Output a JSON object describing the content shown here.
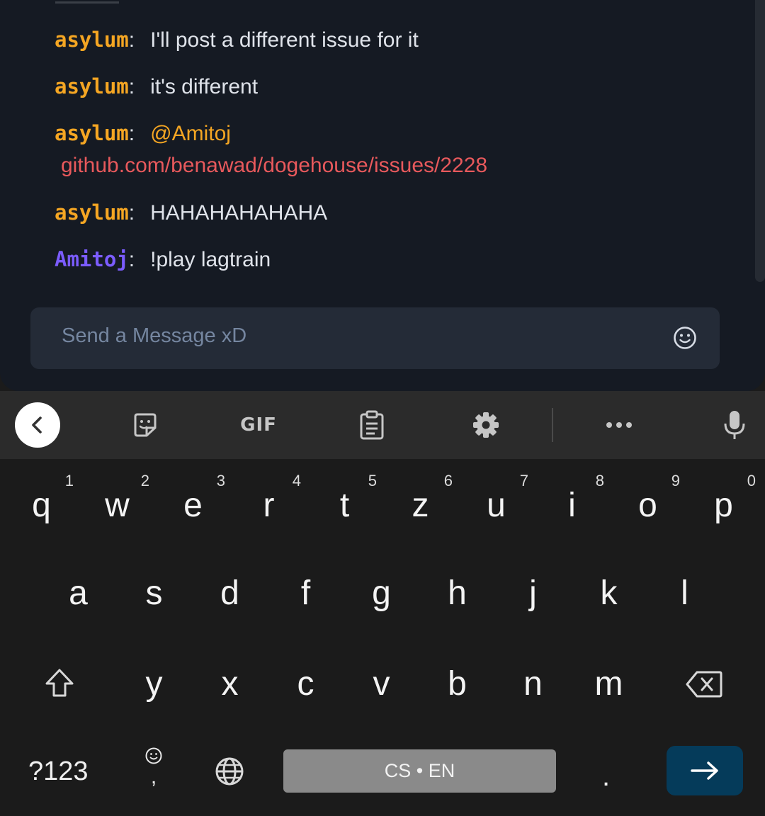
{
  "chat": {
    "messages": [
      {
        "user": "asylum",
        "colon": ":",
        "text": "I'll post a different issue for it",
        "user_color": "#f5a623"
      },
      {
        "user": "asylum",
        "colon": ":",
        "text": "it's different",
        "user_color": "#f5a623"
      },
      {
        "user": "asylum",
        "colon": ":",
        "text": "@Amitoj",
        "link": "github.com/benawad/dogehouse/issues/2228",
        "user_color": "#f5a623"
      },
      {
        "user": "asylum",
        "colon": ":",
        "text": "HAHAHAHAHAHA",
        "user_color": "#f5a623"
      },
      {
        "user": "Amitoj",
        "colon": ":",
        "text": "!play lagtrain",
        "user_color": "#7b5cff"
      }
    ],
    "input": {
      "placeholder": "Send a Message xD",
      "emoji_icon": "smiley-icon"
    },
    "colors": {
      "background": "#151a23",
      "input_bg": "#242b37",
      "link": "#e8595c",
      "mention": "#f5a623"
    }
  },
  "keyboard": {
    "toolbar": {
      "gif_label": "GIF",
      "icons": [
        "back-arrow-icon",
        "sticker-icon",
        "clipboard-icon",
        "gear-icon",
        "more-icon",
        "microphone-icon"
      ]
    },
    "rows": {
      "row1": [
        {
          "key": "q",
          "hint": "1"
        },
        {
          "key": "w",
          "hint": "2"
        },
        {
          "key": "e",
          "hint": "3"
        },
        {
          "key": "r",
          "hint": "4"
        },
        {
          "key": "t",
          "hint": "5"
        },
        {
          "key": "z",
          "hint": "6"
        },
        {
          "key": "u",
          "hint": "7"
        },
        {
          "key": "i",
          "hint": "8"
        },
        {
          "key": "o",
          "hint": "9"
        },
        {
          "key": "p",
          "hint": "0"
        }
      ],
      "row2": [
        "a",
        "s",
        "d",
        "f",
        "g",
        "h",
        "j",
        "k",
        "l"
      ],
      "row3": [
        "y",
        "x",
        "c",
        "v",
        "b",
        "n",
        "m"
      ]
    },
    "bottom": {
      "symbols_label": "?123",
      "emoji_comma": ",",
      "space_label": "CS • EN",
      "period": "."
    },
    "colors": {
      "enter_bg": "#053b5a",
      "space_bg": "#8a8a8a"
    }
  }
}
